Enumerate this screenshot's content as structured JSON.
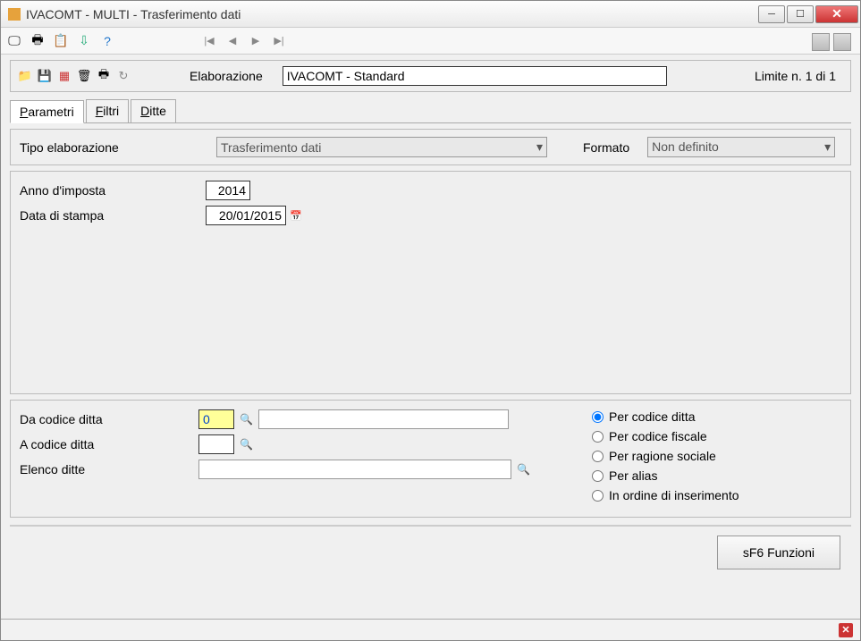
{
  "window": {
    "title": "IVACOMT  -  MULTI -   Trasferimento dati"
  },
  "toolbar2": {
    "label": "Elaborazione",
    "input_value": "IVACOMT - Standard",
    "limit_text": "Limite n. 1 di 1"
  },
  "tabs": {
    "parametri": "Parametri",
    "filtri": "Filtri",
    "ditte": "Ditte"
  },
  "panel1": {
    "tipo_label": "Tipo elaborazione",
    "tipo_value": "Trasferimento dati",
    "formato_label": "Formato",
    "formato_value": "Non definito"
  },
  "form": {
    "anno_label": "Anno d'imposta",
    "anno_value": "2014",
    "data_label": "Data di stampa",
    "data_value": "20/01/2015"
  },
  "bottom": {
    "da_label": "Da codice ditta",
    "da_value": "0",
    "a_label": "A codice ditta",
    "a_value": "",
    "elenco_label": "Elenco ditte",
    "elenco_value": ""
  },
  "radios": {
    "r1": "Per codice ditta",
    "r2": "Per codice fiscale",
    "r3": "Per ragione sociale",
    "r4": "Per alias",
    "r5": "In ordine di inserimento"
  },
  "buttons": {
    "funzioni": "sF6 Funzioni"
  }
}
